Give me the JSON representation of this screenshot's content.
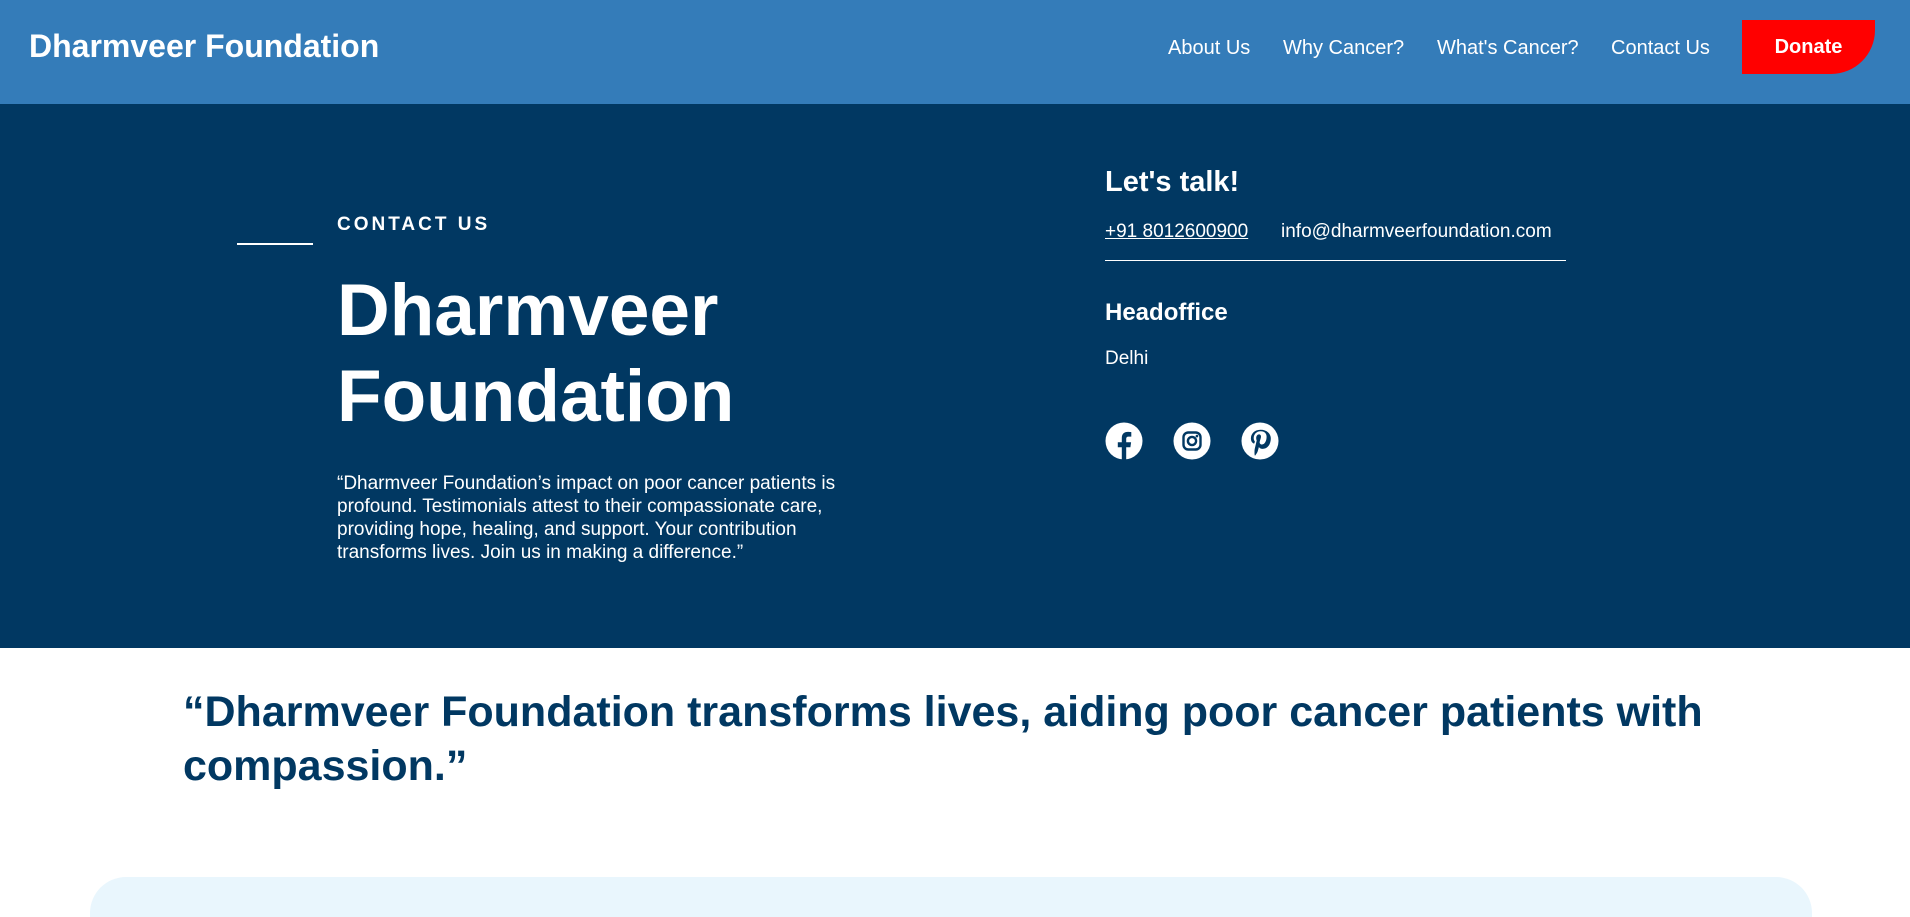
{
  "header": {
    "brand": "Dharmveer Foundation",
    "nav": [
      {
        "label": "About Us"
      },
      {
        "label": "Why Cancer?"
      },
      {
        "label": "What's Cancer?"
      },
      {
        "label": "Contact Us"
      }
    ],
    "donate_label": "Donate"
  },
  "hero": {
    "eyebrow": "CONTACT US",
    "title_line1": "Dharmveer",
    "title_line2": "Foundation",
    "quote": "“Dharmveer Foundation’s impact on poor cancer patients is profound. Testimonials attest to their compassionate care, providing hope, healing, and support. Your contribution transforms lives. Join us in making a difference.”"
  },
  "contact": {
    "heading": "Let's talk!",
    "phone": "+91 8012600900",
    "email": "info@dharmveerfoundation.com",
    "office_heading": "Headoffice",
    "office_city": "Delhi",
    "socials": [
      "facebook-icon",
      "instagram-icon",
      "pinterest-icon"
    ]
  },
  "testimonial": {
    "quote": "“Dharmveer Foundation transforms lives, aiding poor cancer patients with compassion.”"
  },
  "colors": {
    "header_bg": "#347cb9",
    "hero_bg": "#013862",
    "donate_bg": "#ff0000",
    "quote_text": "#013862",
    "card_bg": "#e9f6fd"
  }
}
